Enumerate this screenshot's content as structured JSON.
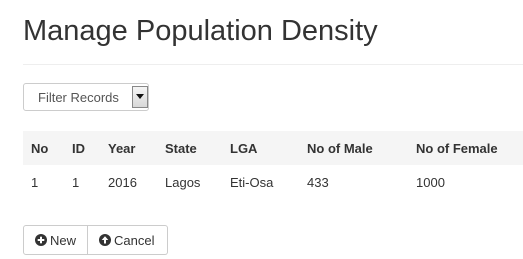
{
  "page": {
    "title": "Manage Population Density"
  },
  "filter": {
    "selected": "Filter Records"
  },
  "table": {
    "headers": [
      "No",
      "ID",
      "Year",
      "State",
      "LGA",
      "No of Male",
      "No of Female"
    ],
    "rows": [
      [
        "1",
        "1",
        "2016",
        "Lagos",
        "Eti-Osa",
        "433",
        "1000"
      ]
    ]
  },
  "actions": {
    "new_label": "New",
    "cancel_label": "Cancel",
    "new_icon": "plus-circle-icon",
    "cancel_icon": "arrow-up-circle-icon"
  },
  "colors": {
    "header_bg": "#f5f5f5",
    "text": "#333333",
    "border": "#cccccc"
  }
}
